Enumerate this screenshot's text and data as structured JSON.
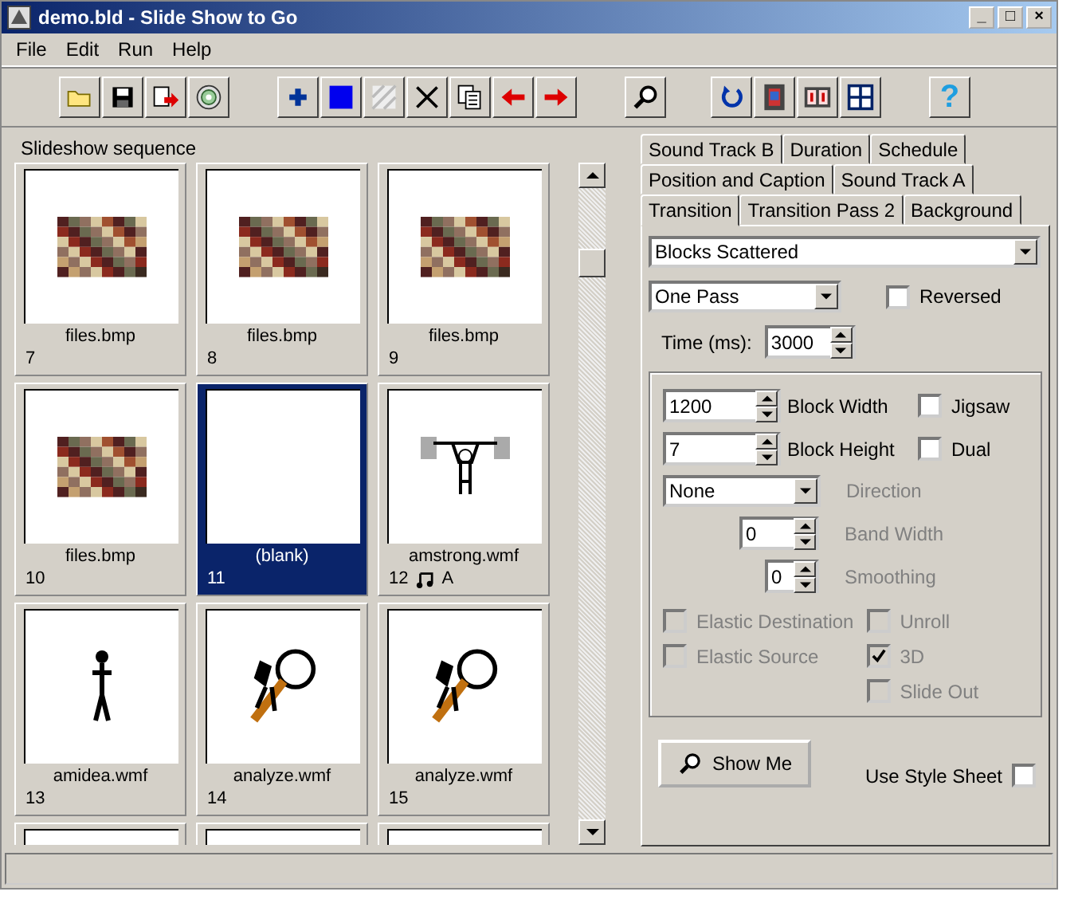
{
  "window": {
    "title": "demo.bld - Slide Show to Go",
    "controls": [
      "_",
      "□",
      "×"
    ]
  },
  "menu": [
    {
      "label": "File"
    },
    {
      "label": "Edit"
    },
    {
      "label": "Run"
    },
    {
      "label": "Help"
    }
  ],
  "toolbar": {
    "help_glyph": "?"
  },
  "sequence": {
    "label": "Slideshow sequence",
    "slides": [
      {
        "kind": "mosaic",
        "name": "files.bmp",
        "number": "7",
        "selected": false
      },
      {
        "kind": "mosaic",
        "name": "files.bmp",
        "number": "8",
        "selected": false
      },
      {
        "kind": "mosaic",
        "name": "files.bmp",
        "number": "9",
        "selected": false
      },
      {
        "kind": "mosaic",
        "name": "files.bmp",
        "number": "10",
        "selected": false
      },
      {
        "kind": "blank",
        "name": "(blank)",
        "number": "11",
        "selected": true
      },
      {
        "kind": "lifter",
        "name": "amstrong.wmf",
        "number": "12",
        "selected": false,
        "sound": true,
        "track": "A"
      },
      {
        "kind": "figure",
        "name": "amidea.wmf",
        "number": "13",
        "selected": false
      },
      {
        "kind": "magnifier",
        "name": "analyze.wmf",
        "number": "14",
        "selected": false
      },
      {
        "kind": "magnifier",
        "name": "analyze.wmf",
        "number": "15",
        "selected": false
      },
      {
        "kind": "cut",
        "selected": false
      },
      {
        "kind": "cut",
        "selected": false
      },
      {
        "kind": "cut",
        "selected": false
      }
    ]
  },
  "tab_rows": [
    [
      {
        "label": "Sound Track B",
        "selected": false
      },
      {
        "label": "Duration",
        "selected": false
      },
      {
        "label": "Schedule",
        "selected": false
      }
    ],
    [
      {
        "label": "Position and Caption",
        "selected": false
      },
      {
        "label": "Sound Track A",
        "selected": false
      }
    ],
    [
      {
        "label": "Transition",
        "selected": true
      },
      {
        "label": "Transition Pass 2",
        "selected": false
      },
      {
        "label": "Background",
        "selected": false
      }
    ]
  ],
  "transition": {
    "effect": "Blocks Scattered",
    "pass": "One Pass",
    "reversed": {
      "label": "Reversed",
      "checked": false
    },
    "time": {
      "label": "Time (ms):",
      "value": "3000"
    },
    "block_width": {
      "value": "1200",
      "label": "Block Width"
    },
    "jigsaw": {
      "label": "Jigsaw",
      "checked": false
    },
    "block_height": {
      "value": "7",
      "label": "Block Height"
    },
    "dual": {
      "label": "Dual",
      "checked": false
    },
    "direction": {
      "value": "None",
      "label": "Direction",
      "disabled": true
    },
    "band_width": {
      "value": "0",
      "label": "Band Width",
      "disabled": true
    },
    "smoothing": {
      "value": "0",
      "label": "Smoothing",
      "disabled": true
    },
    "options_left": [
      {
        "label": "Elastic Destination",
        "checked": false,
        "disabled": true
      },
      {
        "label": "Elastic Source",
        "checked": false,
        "disabled": true
      }
    ],
    "options_right": [
      {
        "label": "Unroll",
        "checked": false,
        "disabled": true
      },
      {
        "label": "3D",
        "checked": true,
        "disabled": true
      },
      {
        "label": "Slide Out",
        "checked": false,
        "disabled": true
      }
    ],
    "show_me": "Show Me",
    "style_sheet": {
      "label": "Use Style Sheet",
      "checked": false
    }
  }
}
